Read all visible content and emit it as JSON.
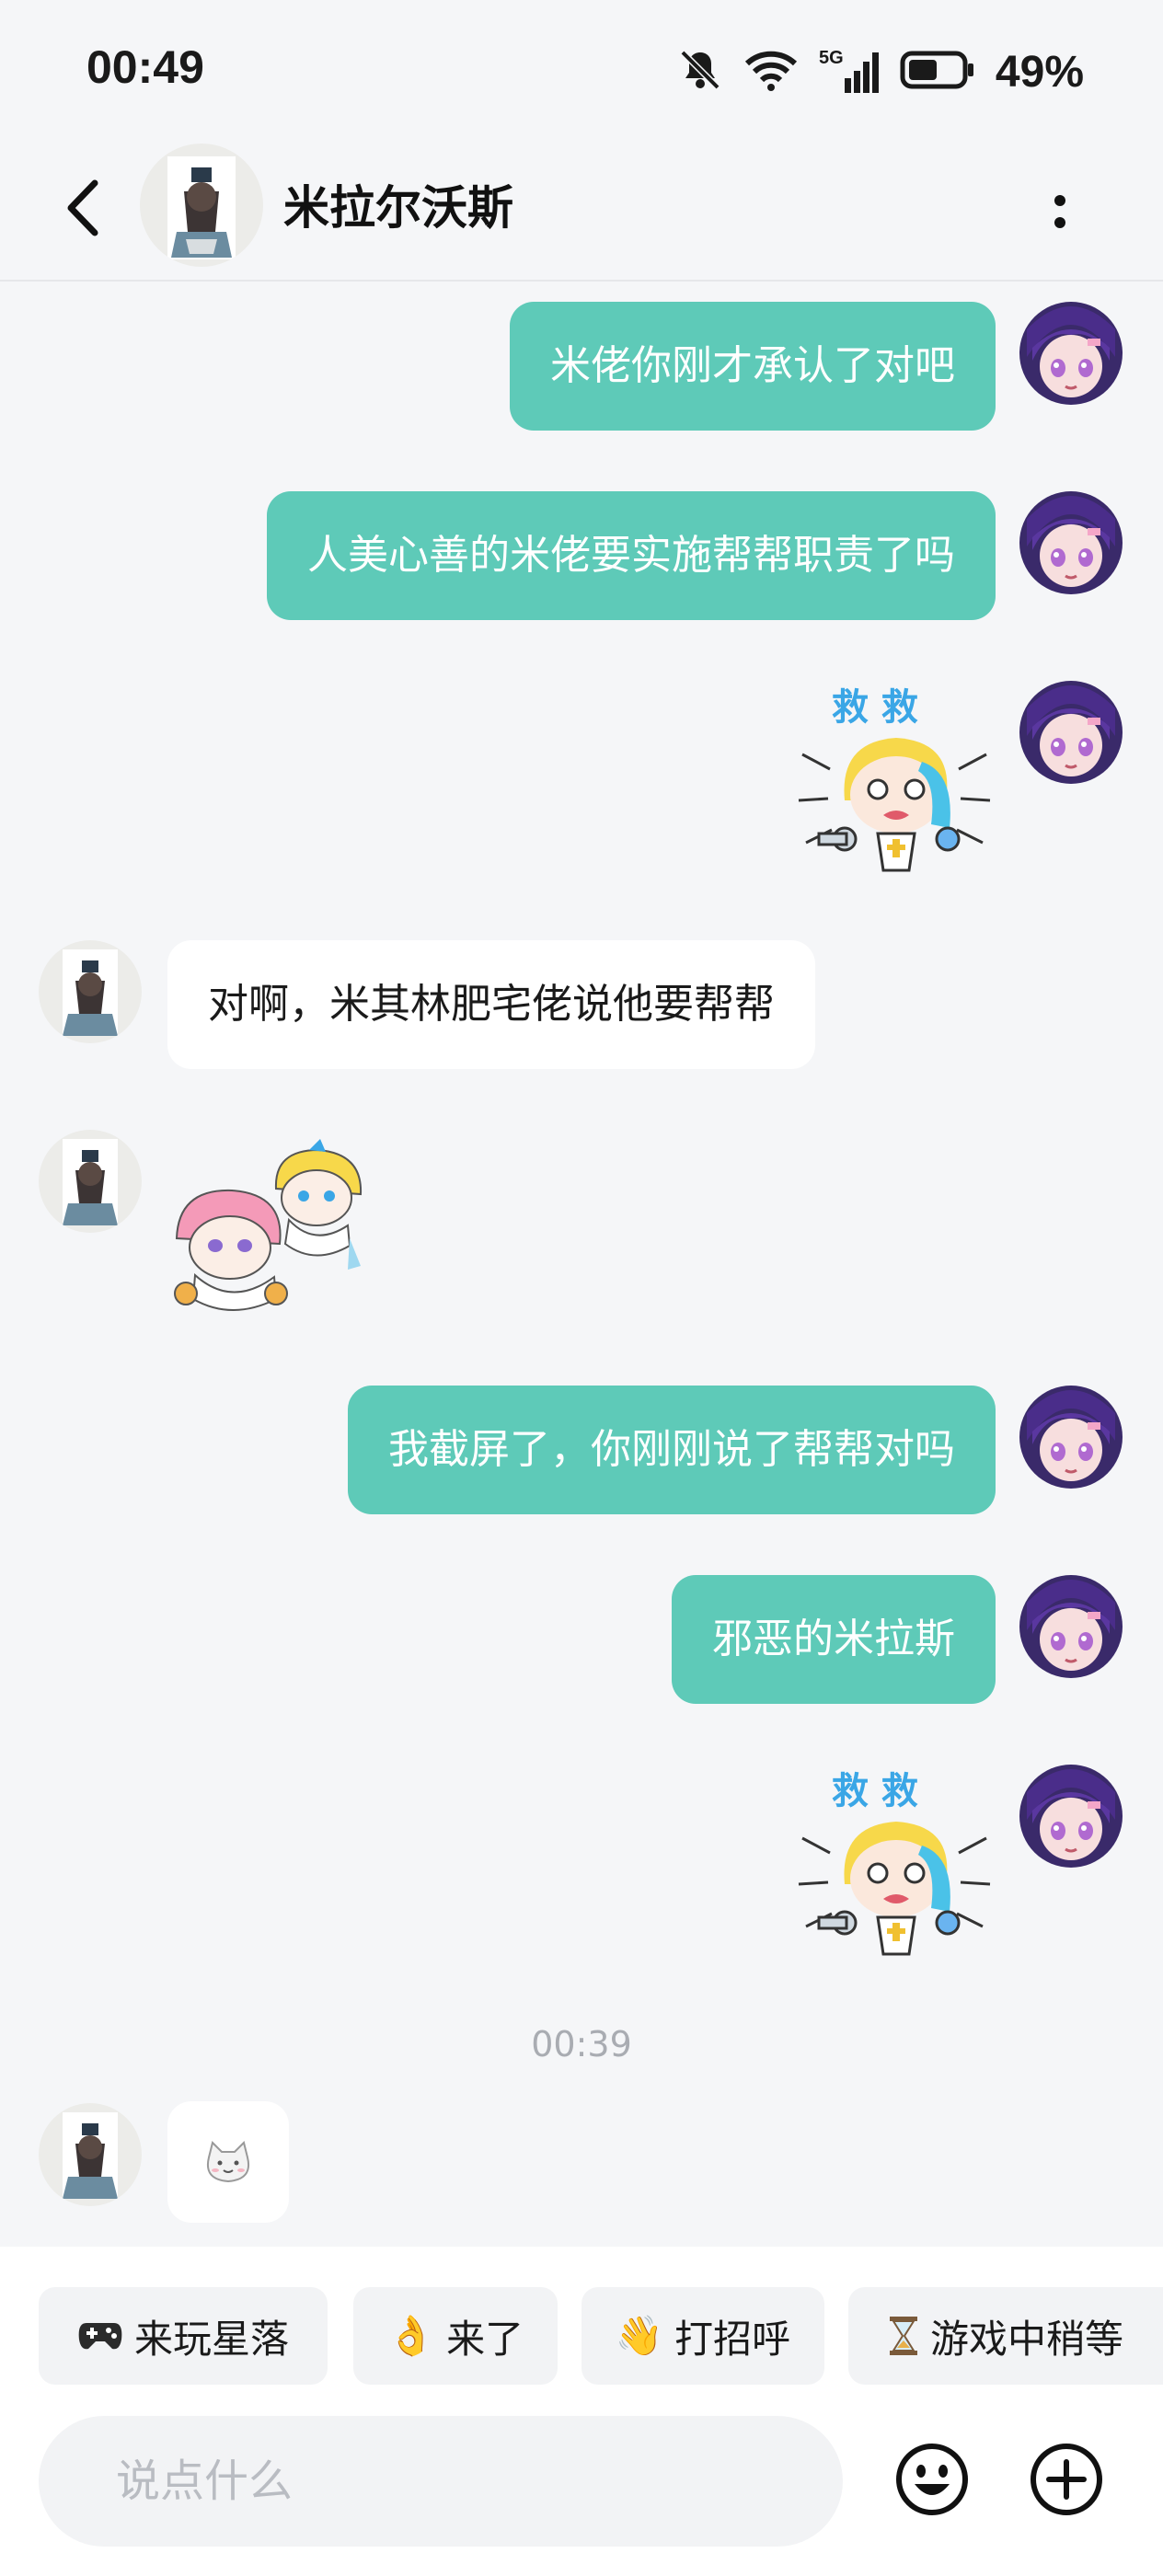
{
  "status_bar": {
    "time": "00:49",
    "network": "5G",
    "battery": "49%"
  },
  "header": {
    "contact_name": "米拉尔沃斯",
    "back_icon": "chevron-left-icon",
    "more_icon": "more-vertical-icon"
  },
  "messages": [
    {
      "sender": "me",
      "type": "text",
      "text": "米佬你刚才承认了对吧"
    },
    {
      "sender": "me",
      "type": "text",
      "text": "人美心善的米佬要实施帮帮职责了吗"
    },
    {
      "sender": "me",
      "type": "sticker",
      "caption": "救 救"
    },
    {
      "sender": "them",
      "type": "text",
      "text": "对啊，米其林肥宅佬说他要帮帮"
    },
    {
      "sender": "them",
      "type": "sticker"
    },
    {
      "sender": "me",
      "type": "text",
      "text": "我截屏了，你刚刚说了帮帮对吗"
    },
    {
      "sender": "me",
      "type": "text",
      "text": "邪恶的米拉斯"
    },
    {
      "sender": "me",
      "type": "sticker",
      "caption": "救 救"
    },
    {
      "sender": "system",
      "type": "timestamp",
      "text": "00:39"
    },
    {
      "sender": "them",
      "type": "sticker"
    }
  ],
  "quick_replies": [
    {
      "icon": "game-controller-icon",
      "emoji": "🎮",
      "label": "来玩星落"
    },
    {
      "icon": "ok-hand-icon",
      "emoji": "👌",
      "label": "来了"
    },
    {
      "icon": "waving-hand-icon",
      "emoji": "👋",
      "label": "打招呼"
    },
    {
      "icon": "hourglass-icon",
      "emoji": "⏳",
      "label": "游戏中稍等"
    }
  ],
  "input": {
    "placeholder": "说点什么",
    "value": ""
  },
  "colors": {
    "my_bubble": "#5ecab8",
    "their_bubble": "#ffffff",
    "background": "#f5f6f8"
  }
}
